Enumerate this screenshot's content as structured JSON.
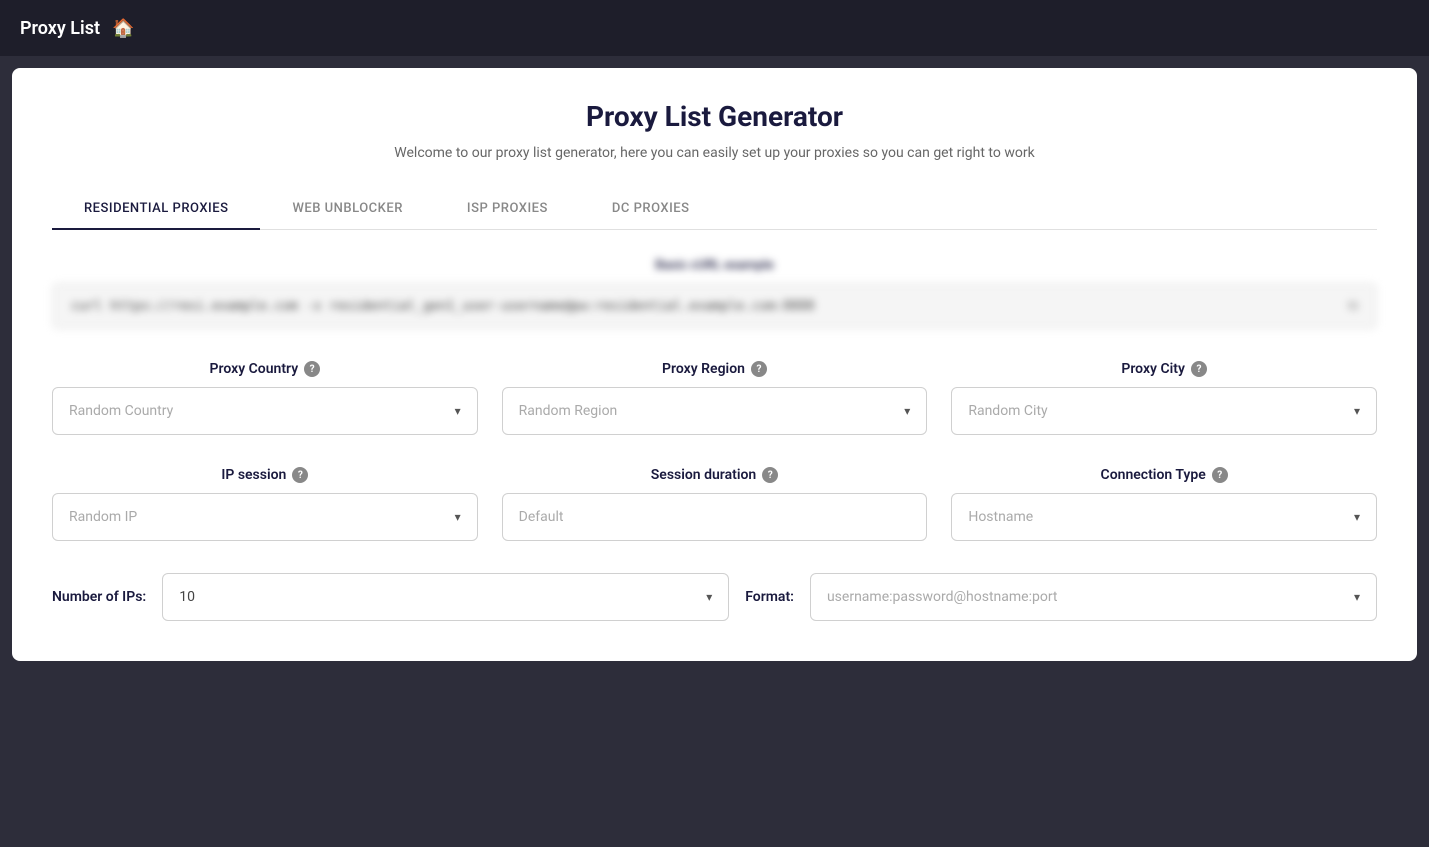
{
  "navbar": {
    "title": "Proxy List",
    "home_icon": "🏠"
  },
  "card": {
    "title": "Proxy List Generator",
    "subtitle": "Welcome to our proxy list generator, here you can easily set up your proxies so you can get right to work",
    "tabs": [
      {
        "label": "RESIDENTIAL PROXIES",
        "active": true
      },
      {
        "label": "WEB UNBLOCKER",
        "active": false
      },
      {
        "label": "ISP PROXIES",
        "active": false
      },
      {
        "label": "DC PROXIES",
        "active": false
      }
    ],
    "url_label": "Basic cURL example",
    "url_text": "curl https://resi.example.com -x residential_gen1_user-username@pw:residential.example.com:8888",
    "proxy_country": {
      "label": "Proxy Country",
      "placeholder": "Random Country"
    },
    "proxy_region": {
      "label": "Proxy Region",
      "placeholder": "Random Region"
    },
    "proxy_city": {
      "label": "Proxy City",
      "placeholder": "Random City"
    },
    "ip_session": {
      "label": "IP session",
      "placeholder": "Random IP"
    },
    "session_duration": {
      "label": "Session duration",
      "placeholder": "Default"
    },
    "connection_type": {
      "label": "Connection Type",
      "placeholder": "Hostname"
    },
    "number_of_ips": {
      "label": "Number of IPs:",
      "value": "10"
    },
    "format": {
      "label": "Format:",
      "placeholder": "username:password@hostname:port"
    }
  }
}
